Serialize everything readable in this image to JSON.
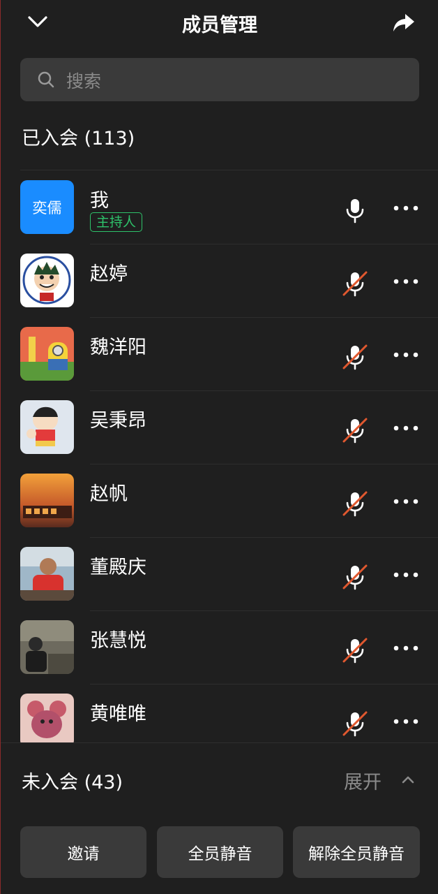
{
  "header": {
    "title": "成员管理",
    "back_icon": "chevron-down-icon",
    "share_icon": "share-icon"
  },
  "search": {
    "placeholder": "搜索"
  },
  "joined": {
    "label": "已入会 (113)"
  },
  "members": [
    {
      "name": "我",
      "role": "主持人",
      "muted": false,
      "avatar_text": "奕儒",
      "avatar": "text"
    },
    {
      "name": "赵婷",
      "muted": true,
      "avatar": "anime-boy"
    },
    {
      "name": "魏洋阳",
      "muted": true,
      "avatar": "minion"
    },
    {
      "name": "吴秉昂",
      "muted": true,
      "avatar": "crayon"
    },
    {
      "name": "赵帆",
      "muted": true,
      "avatar": "sunset"
    },
    {
      "name": "董殿庆",
      "muted": true,
      "avatar": "photo-man"
    },
    {
      "name": "张慧悦",
      "muted": true,
      "avatar": "photo-dark"
    },
    {
      "name": "黄唯唯",
      "muted": true,
      "avatar": "cartoon-mouse"
    }
  ],
  "not_joined": {
    "label": "未入会 (43)",
    "expand": "展开"
  },
  "footer": {
    "invite": "邀请",
    "mute_all": "全员静音",
    "unmute_all": "解除全员静音"
  },
  "colors": {
    "background": "#1f1f1f",
    "host_badge": "#2ec26a",
    "muted_slash": "#e0582f",
    "avatar_blue": "#1a8cff"
  }
}
